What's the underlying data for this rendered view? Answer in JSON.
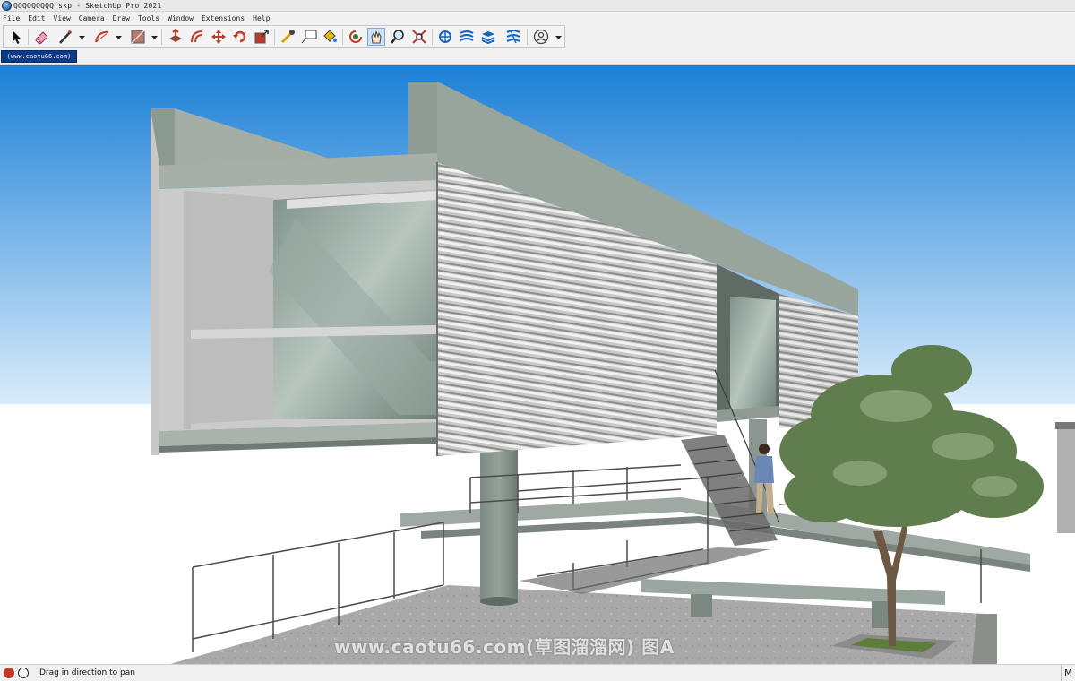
{
  "window": {
    "title": "QQQQQQQQQ.skp - SketchUp Pro 2021"
  },
  "menu": {
    "items": [
      "File",
      "Edit",
      "View",
      "Camera",
      "Draw",
      "Tools",
      "Window",
      "Extensions",
      "Help"
    ]
  },
  "toolbar": {
    "tools": [
      {
        "name": "select-icon"
      },
      {
        "name": "eraser-icon"
      },
      {
        "name": "line-icon",
        "has_dropdown": true
      },
      {
        "name": "arc-icon",
        "has_dropdown": true
      },
      {
        "name": "rectangle-icon",
        "has_dropdown": true
      },
      {
        "name": "push-pull-icon"
      },
      {
        "name": "offset-icon"
      },
      {
        "name": "move-icon"
      },
      {
        "name": "rotate-icon"
      },
      {
        "name": "scale-icon"
      },
      {
        "name": "tape-measure-icon"
      },
      {
        "name": "text-icon"
      },
      {
        "name": "paint-bucket-icon"
      },
      {
        "name": "orbit-icon"
      },
      {
        "name": "pan-icon",
        "active": true
      },
      {
        "name": "zoom-icon"
      },
      {
        "name": "zoom-extents-icon"
      },
      {
        "name": "warehouse-icon"
      },
      {
        "name": "extension-warehouse-icon"
      },
      {
        "name": "layout-icon"
      },
      {
        "name": "extension-manager-icon"
      },
      {
        "name": "account-icon",
        "has_dropdown": true
      }
    ]
  },
  "scene_tab": {
    "label": "(www.caotu66.com)"
  },
  "viewport": {
    "watermark": "www.caotu66.com(草图溜溜网) 图A",
    "sky_top": "#1b7fd6",
    "sky_bottom": "#d9ecfb"
  },
  "status": {
    "message": "Drag in direction to pan",
    "measurements_label": "M"
  }
}
